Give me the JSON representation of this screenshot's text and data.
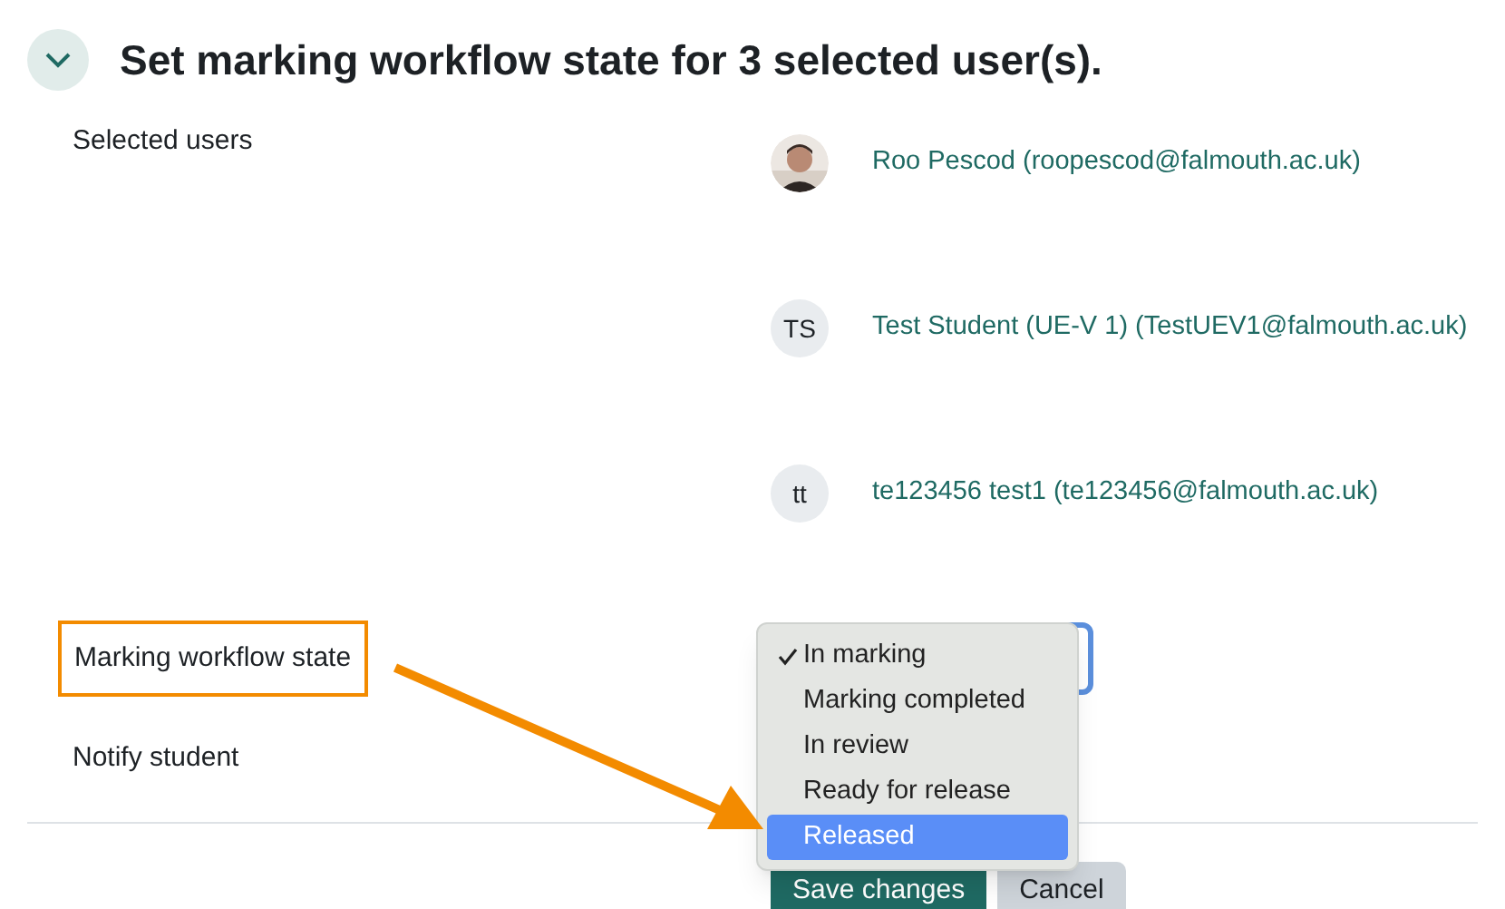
{
  "section": {
    "expanded": true,
    "title": "Set marking workflow state for 3 selected user(s)."
  },
  "selected_users": {
    "label": "Selected users",
    "users": [
      {
        "name": "Roo Pescod (roopescod@falmouth.ac.uk)"
      },
      {
        "kind": "initials",
        "initials": "TS",
        "name": "Test Student (UE-V 1) (TestUEV1@falmouth.ac.uk)"
      },
      {
        "kind": "initials",
        "initials": "tt",
        "name": "te123456 test1 (te123456@falmouth.ac.uk)"
      }
    ]
  },
  "workflow_state": {
    "label": "Marking workflow state",
    "highlighted": true,
    "options": [
      {
        "label": "In marking",
        "checked": true,
        "selected": false
      },
      {
        "label": "Marking completed",
        "checked": false,
        "selected": false
      },
      {
        "label": "In review",
        "checked": false,
        "selected": false
      },
      {
        "label": "Ready for release",
        "checked": false,
        "selected": false
      },
      {
        "label": "Released",
        "checked": false,
        "selected": true
      }
    ]
  },
  "notify": {
    "label": "Notify student"
  },
  "buttons": [
    {
      "kind": "primary",
      "label": "Save changes"
    },
    {
      "kind": "secondary",
      "label": "Cancel"
    }
  ]
}
